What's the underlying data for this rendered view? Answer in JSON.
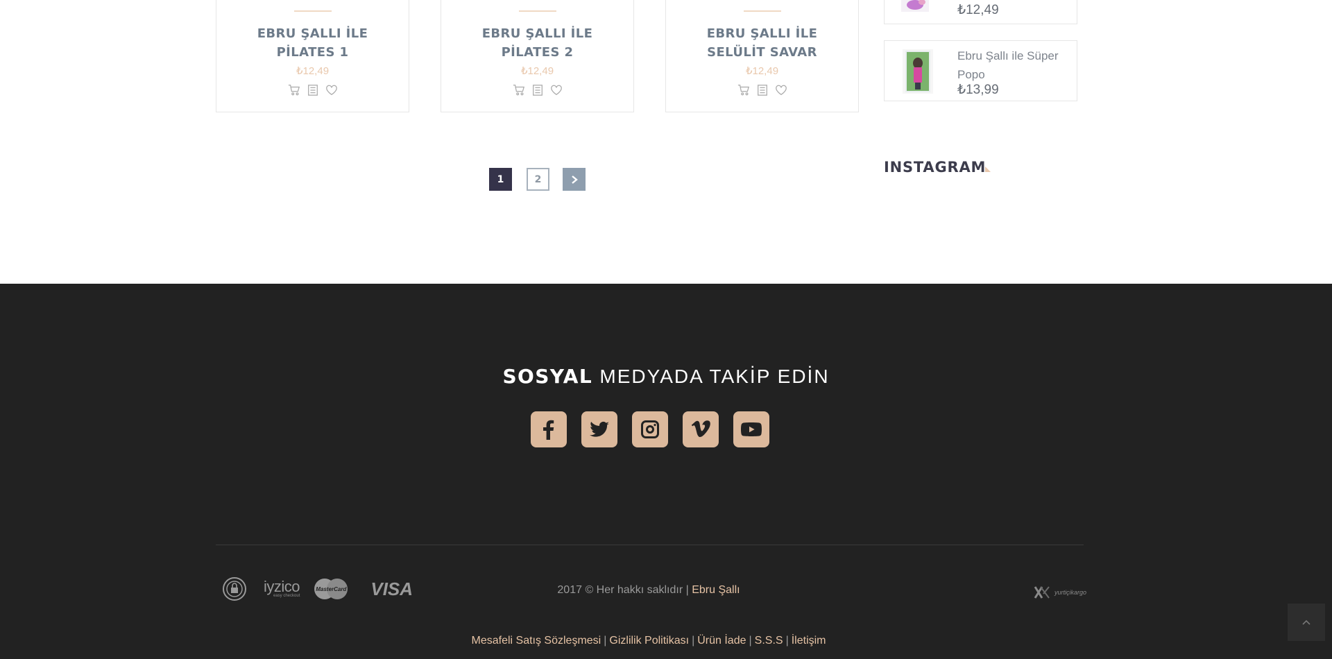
{
  "products": [
    {
      "title": "EBRU ŞALLI İLE PİLATES 1",
      "price": "₺12,49"
    },
    {
      "title": "EBRU ŞALLI İLE PİLATES 2",
      "price": "₺12,49"
    },
    {
      "title": "EBRU ŞALLI İLE SELÜLİT SAVAR",
      "price": "₺12,49"
    }
  ],
  "sidebar": {
    "items": [
      {
        "name": "",
        "price": "₺12,49"
      },
      {
        "name": "Ebru Şallı ile Süper Popo",
        "price": "₺13,99"
      }
    ],
    "instagram_title": "INSTAGRAM"
  },
  "pagination": {
    "pages": [
      "1",
      "2"
    ],
    "current": "1",
    "next_icon": "chevron-right-icon"
  },
  "footer": {
    "follow_bold": "SOSYAL",
    "follow_rest": "MEDYADA TAKİP EDİN",
    "socials": [
      "facebook-icon",
      "twitter-icon",
      "instagram-icon",
      "vimeo-icon",
      "youtube-icon"
    ],
    "payment": {
      "iyzico": "iyzico",
      "iyzico_sub": "easy checkout",
      "mastercard": "MasterCard",
      "visa": "VISA"
    },
    "copyright_prefix": "2017 © Her hakkı saklıdır |",
    "brand": "Ebru Şallı",
    "cargo_text": "yurtiçikargo",
    "links": [
      "Mesafeli Satış Sözleşmesi",
      "Gizlilik Politikası",
      "Ürün İade",
      "S.S.S",
      "İletişim"
    ]
  },
  "colors": {
    "accent": "#dcb99c",
    "footer_bg": "#222222",
    "pager_active": "#35334a",
    "pager_next": "#8e9eae"
  }
}
